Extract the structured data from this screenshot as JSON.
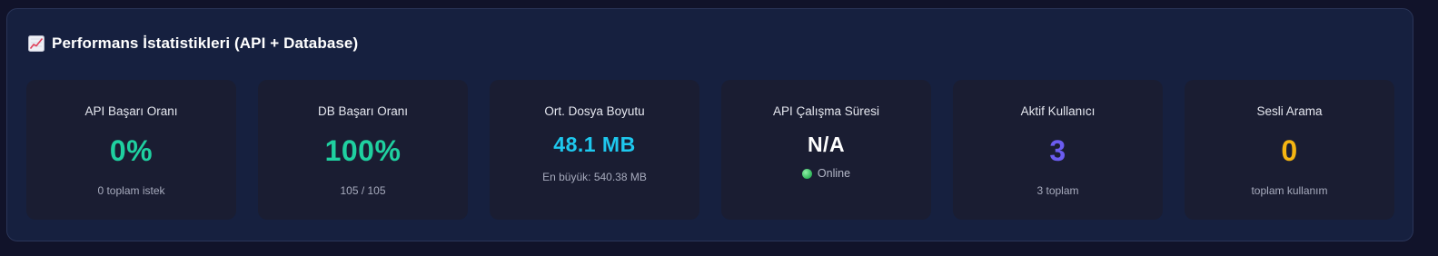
{
  "header": {
    "icon": "chart-increasing-icon",
    "title": "Performans İstatistikleri (API + Database)"
  },
  "colors": {
    "panel_bg": "#16203f",
    "card_bg": "#1a1d32",
    "green": "#1fd0a0",
    "cyan": "#1ec8ee",
    "white": "#ffffff",
    "purple": "#6b5cf0",
    "amber": "#f5b512",
    "online_dot": "#35c266"
  },
  "cards": [
    {
      "label": "API Başarı Oranı",
      "value": "0%",
      "sub": "0 toplam istek",
      "color": "#1fd0a0"
    },
    {
      "label": "DB Başarı Oranı",
      "value": "100%",
      "sub": "105 / 105",
      "color": "#1fd0a0"
    },
    {
      "label": "Ort. Dosya Boyutu",
      "value": "48.1 MB",
      "sub": "En büyük: 540.38 MB",
      "color": "#1ec8ee"
    },
    {
      "label": "API Çalışma Süresi",
      "value": "N/A",
      "status": "Online",
      "color": "#ffffff"
    },
    {
      "label": "Aktif Kullanıcı",
      "value": "3",
      "sub": "3 toplam",
      "color": "#6b5cf0"
    },
    {
      "label": "Sesli Arama",
      "value": "0",
      "sub": "toplam kullanım",
      "color": "#f5b512"
    }
  ]
}
